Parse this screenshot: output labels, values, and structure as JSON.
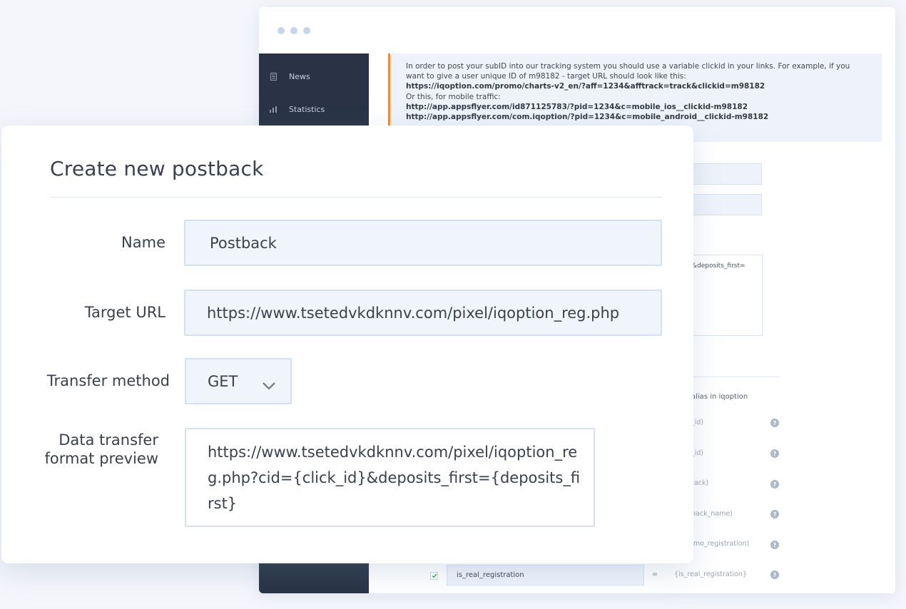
{
  "sidebar": {
    "items": [
      {
        "label": "News",
        "icon": "document-icon"
      },
      {
        "label": "Statistics",
        "icon": "bar-chart-icon"
      }
    ]
  },
  "info": {
    "text": "In order to post your subID into our tracking system you should use a variable clickid in your links. For example, if you want to give a user unique ID of m98182 - target URL should look like this:",
    "link1": "https://iqoption.com/promo/charts-v2_en/?aff=1234&afftrack=track&clickid=m98182",
    "or_text": "Or this, for mobile traffic:",
    "link2": "http://app.appsflyer.com/id871125783/?pid=1234&c=mobile_ios__clickid-m98182",
    "link3": "http://app.appsflyer.com/com.iqoption/?pid=1234&c=mobile_android__clickid-m98182"
  },
  "background_form": {
    "textarea_fragment": "&deposits_first=",
    "alias_header": "alias in iqoption",
    "param_rows": [
      {
        "alias": "_id)"
      },
      {
        "alias": "_id)"
      },
      {
        "alias": "rack)"
      },
      {
        "alias": "back_name)"
      },
      {
        "alias": "emo_registration)"
      },
      {
        "param": "is_real_registration",
        "equals": "=",
        "alias": "{is_real_registration}"
      }
    ]
  },
  "modal": {
    "title": "Create new postback",
    "name_label": "Name",
    "name_value": "Postback",
    "url_label": "Target URL",
    "url_value": "https://www.tsetedvkdknnv.com/pixel/iqoption_reg.php",
    "method_label": "Transfer method",
    "method_value": "GET",
    "preview_label_1": "Data transfer",
    "preview_label_2": "format preview",
    "preview_value": "https://www.tsetedvkdknnv.com/pixel/iqoption_reg.php?cid={click_id}&deposits_first={deposits_first}"
  },
  "colors": {
    "accent": "#f28a2e",
    "sidebar": "#293345",
    "input_bg": "#f0f5fc",
    "check": "#3cb15a"
  }
}
